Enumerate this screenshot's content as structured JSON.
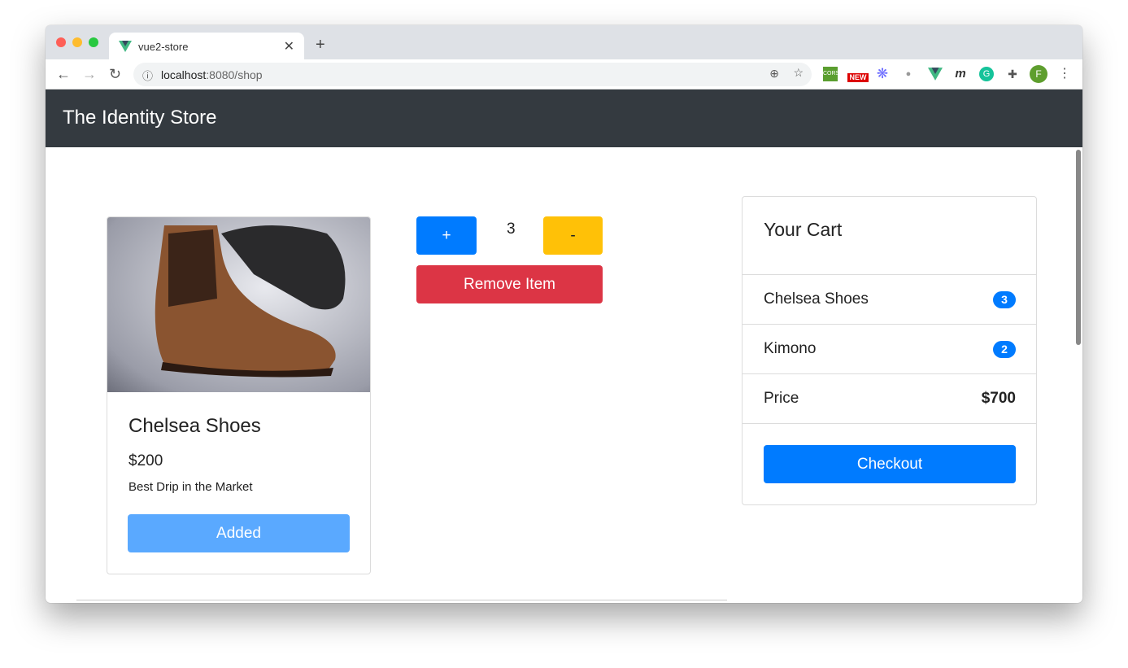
{
  "browser": {
    "tab_title": "vue2-store",
    "url_host": "localhost",
    "url_rest": ":8080/shop",
    "extensions": [
      "cors-icon",
      "new-badge-icon",
      "snowflake-icon",
      "tomato-icon",
      "vue-devtools-icon",
      "m-icon",
      "grammarly-icon",
      "puzzle-icon"
    ],
    "profile_initial": "F",
    "new_label": "NEW",
    "cors_label": "CORS"
  },
  "navbar": {
    "brand": "The Identity Store"
  },
  "product": {
    "name": "Chelsea Shoes",
    "price": "$200",
    "description": "Best Drip in the Market",
    "button": "Added"
  },
  "controls": {
    "plus": "+",
    "quantity": "3",
    "minus": "-",
    "remove": "Remove Item"
  },
  "cart": {
    "title": "Your Cart",
    "items": [
      {
        "name": "Chelsea Shoes",
        "qty": "3"
      },
      {
        "name": "Kimono",
        "qty": "2"
      }
    ],
    "price_label": "Price",
    "price": "$700",
    "checkout": "Checkout"
  },
  "colors": {
    "primary": "#007bff",
    "warning": "#ffc107",
    "danger": "#dc3545",
    "navbar": "#343a40"
  }
}
